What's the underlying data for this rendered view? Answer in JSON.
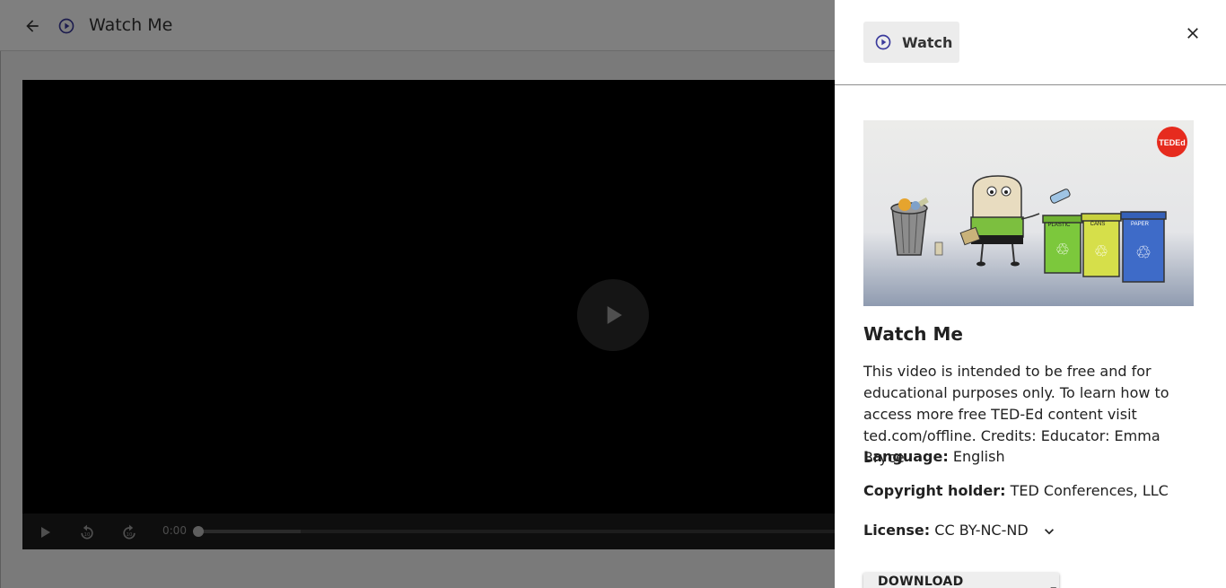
{
  "app": {
    "title": "Watch Me"
  },
  "player": {
    "current_time": "0:00",
    "progress": 0.0,
    "buffered_fraction": 0.104
  },
  "panel": {
    "kind_label": "Watch",
    "resource_title": "Watch Me",
    "description": "This video is intended to be free and for educational purposes only. To learn how to access more free TED-Ed content visit ted.com/offline. Credits: Educator: Emma Bryce",
    "language_label": "Language:",
    "language_value": "English",
    "copyright_label": "Copyright holder:",
    "copyright_value": "TED Conferences, LLC",
    "license_label": "License:",
    "license_value": "CC BY-NC-ND",
    "download_label": "DOWNLOAD RESOURCE"
  },
  "thumbnail": {
    "logo_text": "TEDEd",
    "bin_labels": [
      "PLASTIC",
      "CANS",
      "PAPER"
    ]
  },
  "colors": {
    "accent": "#3a3a9c",
    "ted_red": "#e62b1e"
  }
}
